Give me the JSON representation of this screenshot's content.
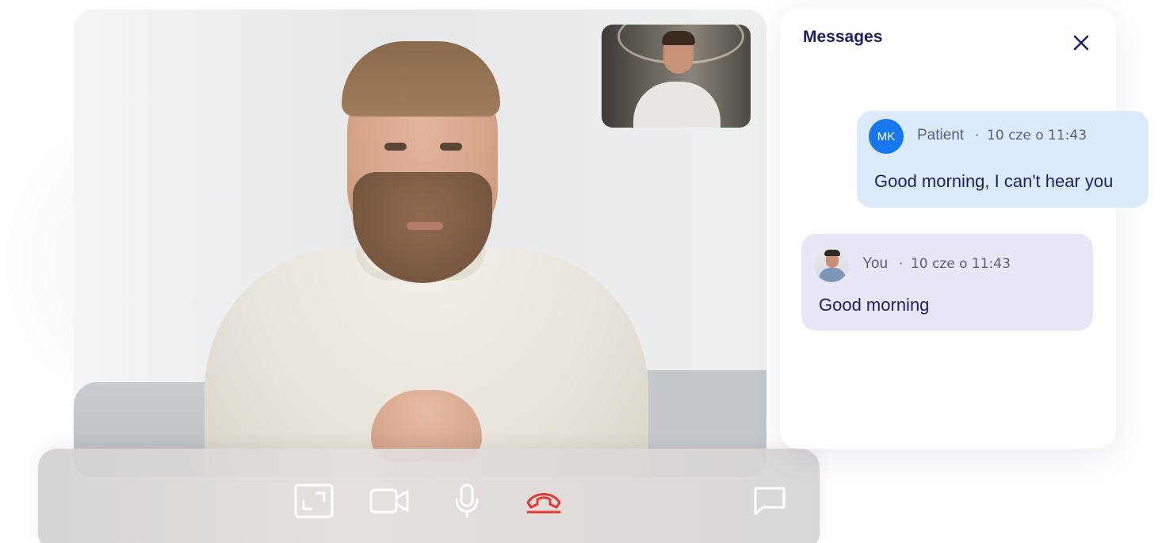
{
  "messages_panel": {
    "title": "Messages",
    "close_icon": "close-icon"
  },
  "messages": [
    {
      "avatar_initials": "MK",
      "author": "Patient",
      "separator": "·",
      "time": "10 cze o 11:43",
      "text": "Good morning, I can't hear you",
      "bubble_color": "#dcebfb",
      "avatar_color": "#1677ee"
    },
    {
      "avatar": "user-photo-avatar",
      "author": "You",
      "separator": "·",
      "time": "10 cze o 11:43",
      "text": "Good morning",
      "bubble_color": "#e9e7f7"
    }
  ],
  "controls": [
    {
      "icon": "fullscreen-icon"
    },
    {
      "icon": "camera-icon"
    },
    {
      "icon": "microphone-icon"
    },
    {
      "icon": "end-call-icon",
      "color": "#e53935"
    },
    {
      "icon": "chat-icon"
    }
  ],
  "colors": {
    "accent": "#1677ee",
    "title_text": "#1d2160",
    "end_call": "#e53935"
  }
}
